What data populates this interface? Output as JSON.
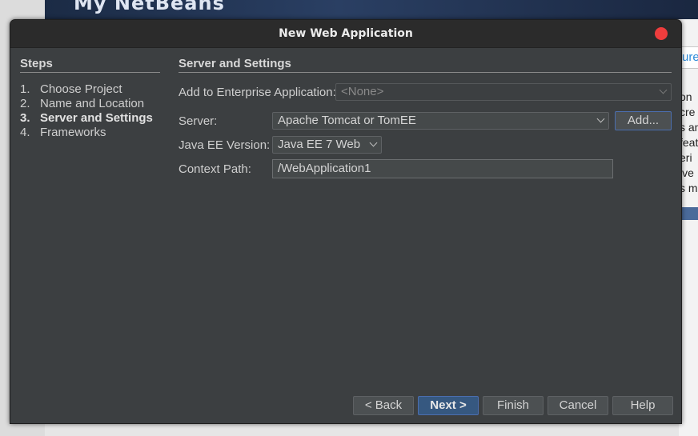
{
  "background": {
    "banner_title": "My NetBeans",
    "right_box_text": "ure",
    "right_lines": [
      "on",
      "cre",
      "s an",
      "feat",
      "eri",
      "ive",
      "s ma"
    ]
  },
  "dialog": {
    "title": "New Web Application",
    "steps_title": "Steps",
    "steps": [
      {
        "num": "1.",
        "label": "Choose Project"
      },
      {
        "num": "2.",
        "label": "Name and Location"
      },
      {
        "num": "3.",
        "label": "Server and Settings"
      },
      {
        "num": "4.",
        "label": "Frameworks"
      }
    ],
    "current_step": 3,
    "section_title": "Server and Settings",
    "enterprise": {
      "label": "Add to Enterprise Application:",
      "value": "<None>"
    },
    "server": {
      "label": "Server:",
      "value": "Apache Tomcat or TomEE",
      "add_label": "Add..."
    },
    "javaee": {
      "label": "Java EE Version:",
      "value": "Java EE 7 Web"
    },
    "context": {
      "label": "Context Path:",
      "value": "/WebApplication1"
    },
    "buttons": {
      "back": "< Back",
      "next": "Next >",
      "finish": "Finish",
      "cancel": "Cancel",
      "help": "Help"
    }
  }
}
